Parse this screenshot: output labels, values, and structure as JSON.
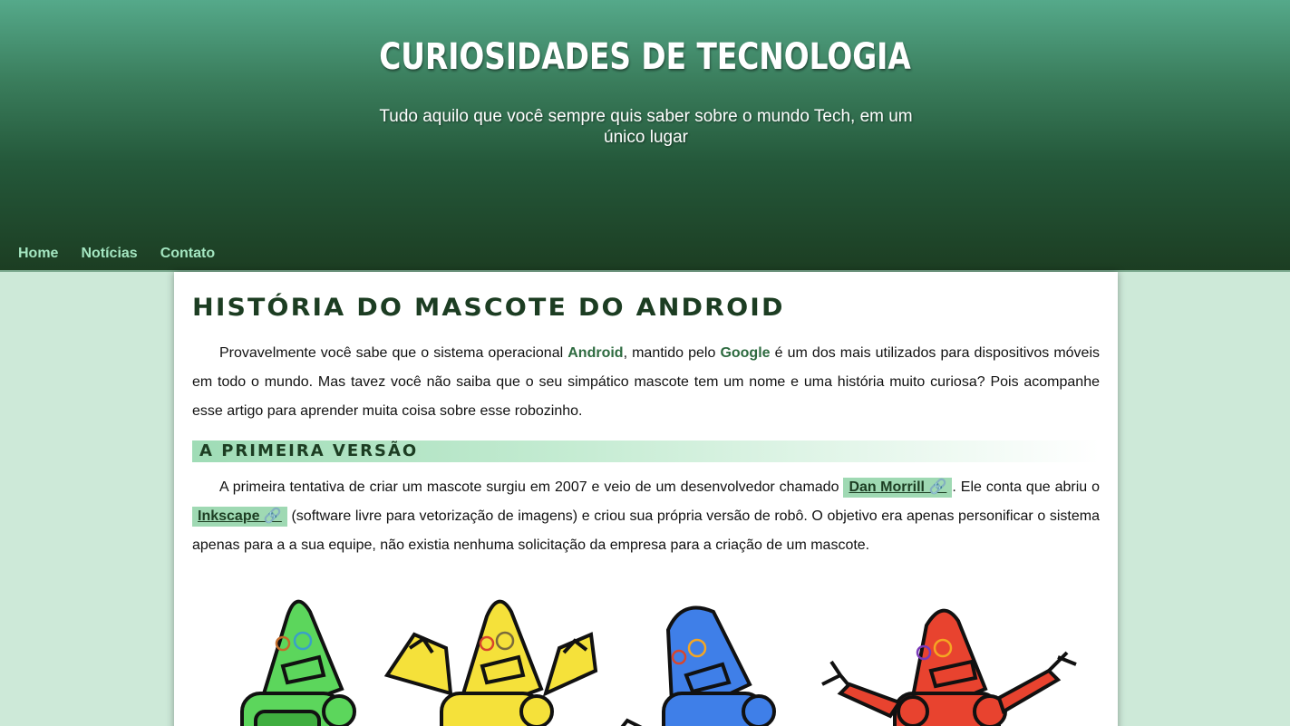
{
  "header": {
    "title": "CURIOSIDADES DE TECNOLOGIA",
    "subtitle": "Tudo aquilo que você sempre quis saber sobre o mundo Tech, em um único lugar"
  },
  "nav": {
    "items": [
      {
        "label": "Home"
      },
      {
        "label": "Notícias"
      },
      {
        "label": "Contato"
      }
    ]
  },
  "article": {
    "title": "História do Mascote do Android",
    "intro": {
      "part1": "Provavelmente você sabe que o sistema operacional ",
      "android": "Android",
      "part2": ", mantido pelo ",
      "google": "Google",
      "part3": " é um dos mais utilizados para dispositivos móveis em todo o mundo. Mas tavez você não saiba que o seu simpático mascote tem um nome e uma história muito curiosa? Pois acompanhe esse artigo para aprender muita coisa sobre esse robozinho."
    },
    "section1": {
      "heading": "A primeira versão",
      "part1": "A primeira tentativa de criar um mascote surgiu em 2007 e veio de um desenvolvedor chamado ",
      "link1": "Dan Morrill 🔗",
      "part2": ". Ele conta que abriu o ",
      "link2": "Inkscape 🔗",
      "part3": " (software livre para vetorização de imagens) e criou sua própria versão de robô. O objetivo era apenas personificar o sistema apenas para a a sua equipe, não existia nenhuma solicitação da empresa para a criação de um mascote."
    }
  },
  "colors": {
    "header_top": "#55a98a",
    "header_bottom": "#1c3d22",
    "nav_link": "#a4e6c1",
    "page_bg": "#cde9d8",
    "accent": "#2e6b40",
    "robots": [
      "#5cd65c",
      "#f5e13a",
      "#3f7fe8",
      "#e8432f"
    ]
  },
  "icons": [
    "link-icon"
  ]
}
